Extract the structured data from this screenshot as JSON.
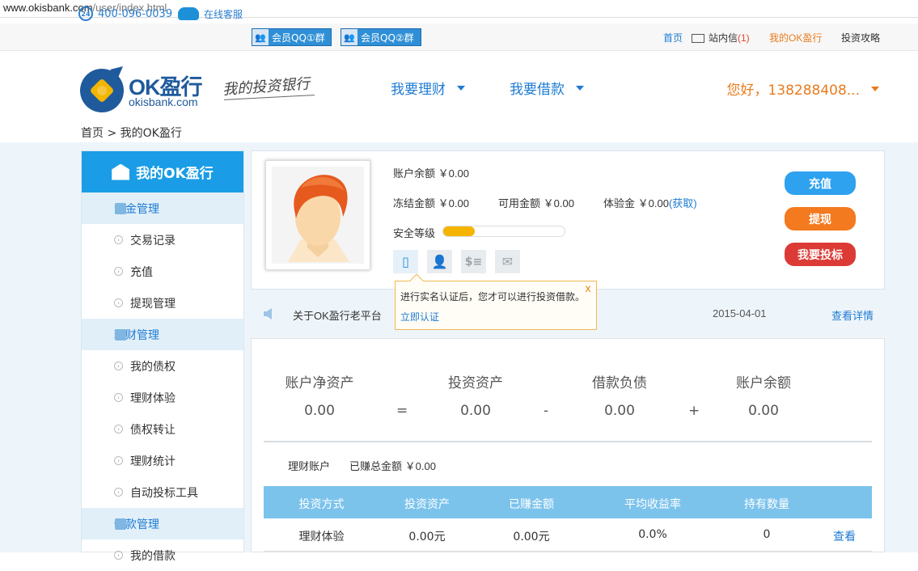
{
  "browser": {
    "url_host": "www.okisbank.com",
    "url_path": "/user/index.html"
  },
  "topbar": {
    "phone": "400-096-0039",
    "phone_icon_text": "24",
    "service": "在线客服",
    "qq1": "会员QQ①群",
    "qq2": "会员QQ②群",
    "home": "首页",
    "inbox": "站内信",
    "inbox_count": "(1)",
    "my_ok": "我的OK盈行",
    "strategy": "投资攻略"
  },
  "header": {
    "logo_title": "OK盈行",
    "logo_sub": "okisbank.com",
    "slogan": "我的投资银行",
    "nav_invest": "我要理财",
    "nav_borrow": "我要借款",
    "user_greeting": "您好，138288408..."
  },
  "breadcrumb": "首页 > 我的OK盈行",
  "sidebar": {
    "title": "我的OK盈行",
    "items": [
      {
        "label": "资金管理",
        "type": "grp"
      },
      {
        "label": "交易记录",
        "type": "sub"
      },
      {
        "label": "充值",
        "type": "sub"
      },
      {
        "label": "提现管理",
        "type": "sub"
      },
      {
        "label": "理财管理",
        "type": "grp"
      },
      {
        "label": "我的债权",
        "type": "sub"
      },
      {
        "label": "理财体验",
        "type": "sub"
      },
      {
        "label": "债权转让",
        "type": "sub"
      },
      {
        "label": "理财统计",
        "type": "sub"
      },
      {
        "label": "自动投标工具",
        "type": "sub"
      },
      {
        "label": "借款管理",
        "type": "grp"
      },
      {
        "label": "我的借款",
        "type": "sub"
      }
    ]
  },
  "account": {
    "balance_label": "账户余额",
    "balance_value": "￥0.00",
    "frozen_label": "冻结金额",
    "frozen_value": "￥0.00",
    "available_label": "可用金额",
    "available_value": "￥0.00",
    "trial_label": "体验金",
    "trial_value": "￥0.00",
    "trial_link": "(获取)",
    "security_label": "安全等级",
    "security_level": 0.26,
    "btn_recharge": "充值",
    "btn_withdraw": "提现",
    "btn_invest": "我要投标",
    "color_recharge": "#2ea1ef",
    "color_withdraw": "#f37a1f",
    "color_invest": "#dc3a35"
  },
  "tooltip": {
    "text": "进行实名认证后，您才可以进行投资借款。",
    "action": "立即认证",
    "close": "x"
  },
  "notice": {
    "title": "关于OK盈行老平台",
    "date": "2015-04-01",
    "more": "查看详情"
  },
  "summary": {
    "net_assets_label": "账户净资产",
    "net_assets_value": "0.00",
    "invest_assets_label": "投资资产",
    "invest_assets_value": "0.00",
    "debt_label": "借款负债",
    "debt_value": "0.00",
    "balance_label": "账户余额",
    "balance_value": "0.00",
    "op_eq": "=",
    "op_minus": "-",
    "op_plus": "+"
  },
  "finance": {
    "account_label": "理财账户",
    "earned_label": "已赚总金额",
    "earned_value": "￥0.00",
    "columns": [
      "投资方式",
      "投资资产",
      "已赚金额",
      "平均收益率",
      "持有数量"
    ],
    "rows": [
      {
        "method": "理财体验",
        "assets": "0.00元",
        "earned": "0.00元",
        "rate": "0.0%",
        "count": "0",
        "action": "查看"
      }
    ]
  }
}
